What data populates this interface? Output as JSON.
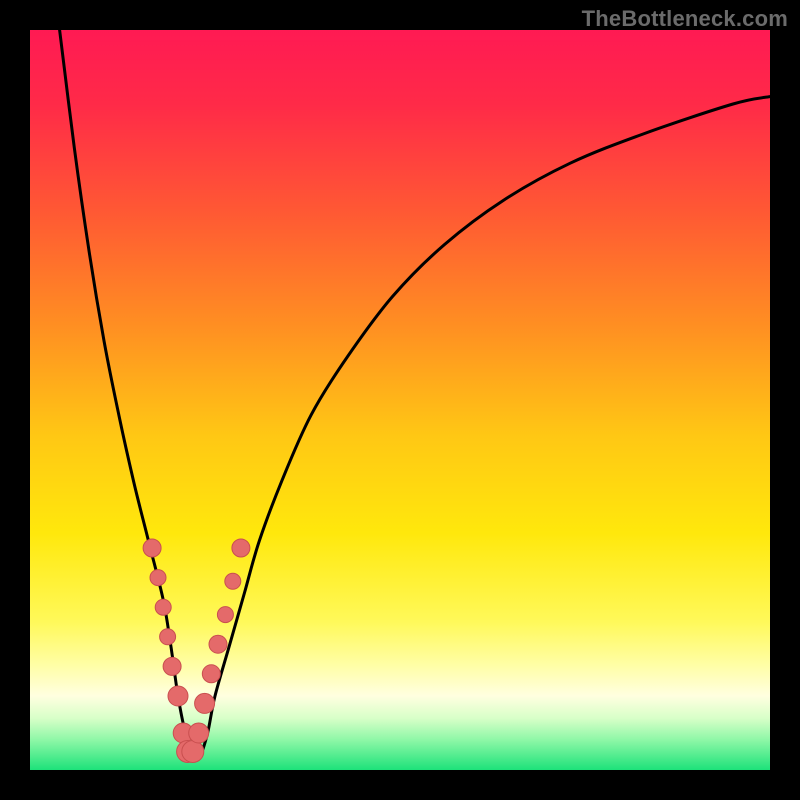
{
  "watermark": {
    "text": "TheBottleneck.com"
  },
  "colors": {
    "black": "#000000",
    "curve": "#000000",
    "dot_fill": "#e46a6a",
    "dot_stroke": "#c94f4f",
    "gradient_stops": [
      {
        "offset": 0.0,
        "color": "#ff1a53"
      },
      {
        "offset": 0.1,
        "color": "#ff2a48"
      },
      {
        "offset": 0.25,
        "color": "#ff5a33"
      },
      {
        "offset": 0.4,
        "color": "#ff8f22"
      },
      {
        "offset": 0.55,
        "color": "#ffc814"
      },
      {
        "offset": 0.68,
        "color": "#ffe80c"
      },
      {
        "offset": 0.8,
        "color": "#fff95a"
      },
      {
        "offset": 0.86,
        "color": "#fffea8"
      },
      {
        "offset": 0.9,
        "color": "#ffffe0"
      },
      {
        "offset": 0.93,
        "color": "#d8ffc8"
      },
      {
        "offset": 0.96,
        "color": "#8cf7a6"
      },
      {
        "offset": 1.0,
        "color": "#1de27a"
      }
    ]
  },
  "chart_data": {
    "type": "line",
    "title": "",
    "xlabel": "",
    "ylabel": "",
    "xlim": [
      0,
      100
    ],
    "ylim": [
      0,
      100
    ],
    "grid": false,
    "legend": false,
    "series": [
      {
        "name": "bottleneck-curve",
        "x": [
          4,
          6,
          8,
          10,
          12,
          14,
          16,
          18,
          19,
          20,
          21,
          22,
          23,
          24,
          25,
          27,
          29,
          31,
          34,
          38,
          43,
          49,
          56,
          64,
          73,
          83,
          95,
          100
        ],
        "y": [
          100,
          84,
          70,
          58,
          48,
          39,
          31,
          23,
          17,
          10,
          5,
          2,
          2,
          5,
          10,
          17,
          24,
          31,
          39,
          48,
          56,
          64,
          71,
          77,
          82,
          86,
          90,
          91
        ]
      }
    ],
    "markers": {
      "name": "sample-points",
      "x": [
        16.5,
        17.3,
        18.0,
        18.6,
        19.2,
        20.0,
        20.7,
        21.3,
        22.0,
        22.8,
        23.6,
        24.5,
        25.4,
        26.4,
        27.4,
        28.5
      ],
      "y": [
        30.0,
        26.0,
        22.0,
        18.0,
        14.0,
        10.0,
        5.0,
        2.5,
        2.5,
        5.0,
        9.0,
        13.0,
        17.0,
        21.0,
        25.5,
        30.0
      ],
      "r": [
        9,
        8,
        8,
        8,
        9,
        10,
        10,
        11,
        11,
        10,
        10,
        9,
        9,
        8,
        8,
        9
      ]
    }
  }
}
